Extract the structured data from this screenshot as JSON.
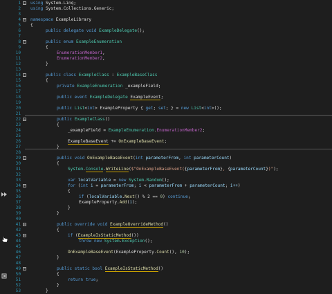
{
  "line_numbers": [
    "1",
    "2",
    "3",
    "4",
    "5",
    "6",
    "7",
    "8",
    "9",
    "10",
    "11",
    "12",
    "13",
    "14",
    "15",
    "16",
    "17",
    "18",
    "19",
    "20",
    "21",
    "22",
    "23",
    "24",
    "25",
    "26",
    "27",
    "28",
    "29",
    "30",
    "31",
    "32",
    "33",
    "34",
    "35",
    "36",
    "37",
    "38",
    "39",
    "40",
    "41",
    "42",
    "43",
    "44",
    "45",
    "46",
    "47",
    "48",
    "49",
    "50",
    "51",
    "52",
    "53"
  ],
  "code": {
    "l1_kw": "using",
    "l1_ns": "System.Linq",
    "l2_kw": "using",
    "l2_ns": "System.Collections.Generic",
    "l4_kw": "namespace",
    "l4_name": "ExampleLibrary",
    "l6_a": "public delegate void",
    "l6_b": "ExampleDelegate",
    "l8_a": "public enum",
    "l8_b": "ExampleEnumeration",
    "l10": "EnumerationMember1",
    "l11": "EnumerationMember2",
    "l14_a": "public class",
    "l14_b": "ExampleClass",
    "l14_c": "ExampleBaseClass",
    "l16_a": "private",
    "l16_b": "ExampleEnumeration",
    "l16_c": "_exampleField",
    "l18_a": "public event",
    "l18_b": "ExampleDelegate",
    "l18_c": "ExampleEvent",
    "l20_a": "public",
    "l20_b": "List",
    "l20_c": "int",
    "l20_d": "ExampleProperty",
    "l20_e": "get",
    "l20_f": "set",
    "l20_g": "new",
    "l20_h": "List",
    "l20_i": "int",
    "l22_a": "public",
    "l22_b": "ExampleClass",
    "l24_a": "_exampleField",
    "l24_b": "ExampleEnumeration",
    "l24_c": "EnumerationMember2",
    "l26_a": "ExampleBaseEvent",
    "l26_b": "OnExampleBaseEvent",
    "l29_a": "public void",
    "l29_b": "OnExampleBaseEvent",
    "l29_c": "int",
    "l29_d": "parameterFrom",
    "l29_e": "int",
    "l29_f": "parameterCount",
    "l31_a": "System",
    "l31_b": "Console",
    "l31_c": "WriteLine",
    "l31_s1": "$\"OnExampleBaseEvent(",
    "l31_p1": "parameterFrom",
    "l31_s2": ", ",
    "l31_p2": "parameterCount",
    "l31_s3": ")\"",
    "l33_a": "var",
    "l33_b": "localVariable",
    "l33_c": "new",
    "l33_d": "System",
    "l33_e": "Random",
    "l34_a": "for",
    "l34_b": "int",
    "l34_c": "i",
    "l34_d": "parameterFrom",
    "l34_e": "i",
    "l34_f": "parameterFrom",
    "l34_g": "parameterCount",
    "l34_h": "i++",
    "l36_a": "if",
    "l36_b": "localVariable",
    "l36_c": "Next",
    "l36_d": "% 2 ==",
    "l36_e": "0",
    "l36_f": "continue",
    "l37_a": "ExampleProperty",
    "l37_b": "Add",
    "l37_c": "i",
    "l41_a": "public override void",
    "l41_b": "ExampleOverrideMethod",
    "l43_a": "if",
    "l43_b": "ExampleIsStaticMethod",
    "l44_a": "throw new",
    "l44_b": "System",
    "l44_c": "Exception",
    "l46_a": "OnExampleBaseEvent",
    "l46_b": "ExampleProperty",
    "l46_c": "Count",
    "l46_d": "10",
    "l49_a": "public static bool",
    "l49_b": "ExampleIsStaticMethod",
    "l51_a": "return",
    "l51_b": "true"
  },
  "colors": {
    "background": "#1e1e1e",
    "keyword": "#569cd6",
    "type": "#4ec9b0",
    "method": "#dcdcaa",
    "enum_member": "#bd63c5",
    "string": "#d69d85",
    "number": "#b5cea8",
    "line_number": "#2b91af"
  },
  "gutter_icons": [
    "breakpoint-arrow-icon",
    "hand-cursor-icon",
    "bookmark-icon"
  ]
}
